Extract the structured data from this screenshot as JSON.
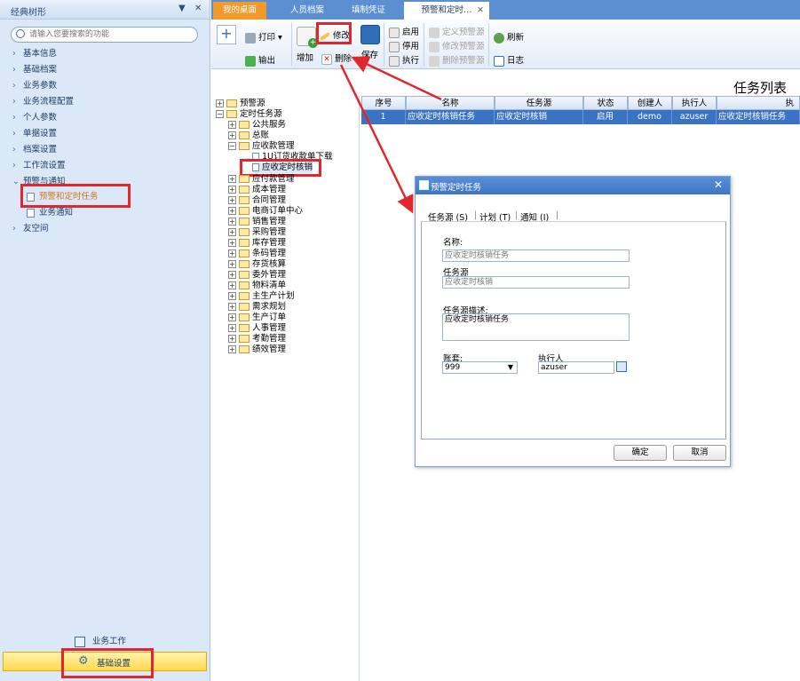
{
  "left_panel": {
    "title": "经典树形",
    "pin_icon": "pin-icon",
    "close_label": "✕",
    "search_placeholder": "请输入您要搜索的功能",
    "nav": [
      "基本信息",
      "基础档案",
      "业务参数",
      "业务流程配置",
      "个人参数",
      "单据设置",
      "档案设置",
      "工作流设置",
      "预警与通知",
      "友空间"
    ],
    "sub_items": [
      "预警和定时任务",
      "业务通知"
    ],
    "bottom": [
      "业务工作",
      "基础设置"
    ]
  },
  "tabs": [
    "我的桌面",
    "人员档案",
    "填制凭证",
    "预警和定时…"
  ],
  "tab_close": "✕",
  "toolbar": {
    "print": "打印",
    "export": "输出",
    "add": "增加",
    "edit": "修改",
    "delete": "删除",
    "save": "保存",
    "enable": "启用",
    "disable": "停用",
    "execute": "执行",
    "define_warning": "定义预警源",
    "modify_warning": "修改预警源",
    "delete_warning": "删除预警源",
    "refresh": "刷新",
    "log": "日志"
  },
  "list_title": "任务列表",
  "tree": {
    "nodes": [
      {
        "label": "预警源",
        "pm": "+"
      },
      {
        "label": "定时任务源",
        "pm": "−"
      },
      {
        "label": "公共服务",
        "pm": "+"
      },
      {
        "label": "总账",
        "pm": "+"
      },
      {
        "label": "应收款管理",
        "pm": "−"
      },
      {
        "label": "1U订货收款单下载",
        "pm": ""
      },
      {
        "label": "应收定时核销",
        "pm": ""
      },
      {
        "label": "应付款管理",
        "pm": "+"
      },
      {
        "label": "成本管理",
        "pm": "+"
      },
      {
        "label": "合同管理",
        "pm": "+"
      },
      {
        "label": "电商订单中心",
        "pm": "+"
      },
      {
        "label": "销售管理",
        "pm": "+"
      },
      {
        "label": "采购管理",
        "pm": "+"
      },
      {
        "label": "库存管理",
        "pm": "+"
      },
      {
        "label": "条码管理",
        "pm": "+"
      },
      {
        "label": "存货核算",
        "pm": "+"
      },
      {
        "label": "委外管理",
        "pm": "+"
      },
      {
        "label": "物料清单",
        "pm": "+"
      },
      {
        "label": "主生产计划",
        "pm": "+"
      },
      {
        "label": "需求规划",
        "pm": "+"
      },
      {
        "label": "生产订单",
        "pm": "+"
      },
      {
        "label": "人事管理",
        "pm": "+"
      },
      {
        "label": "考勤管理",
        "pm": "+"
      },
      {
        "label": "绩效管理",
        "pm": "+"
      }
    ]
  },
  "grid": {
    "headers": [
      "序号",
      "名称",
      "任务源",
      "状态",
      "创建人",
      "执行人",
      "执"
    ],
    "row": [
      "1",
      "应收定时核销任务",
      "应收定时核销",
      "启用",
      "demo",
      "azuser",
      "应收定时核销任务"
    ]
  },
  "dialog": {
    "title": "预警定时任务",
    "tabs": [
      "任务源 (S)",
      "计划 (T)",
      "通知 (I)"
    ],
    "name_label": "名称:",
    "name_value": "应收定时核销任务",
    "source_label": "任务源",
    "source_value": "应收定时核销",
    "desc_label": "任务源描述:",
    "desc_value": "应收定时核销任务",
    "account_label": "账套:",
    "account_value": "999",
    "executor_label": "执行人",
    "executor_value": "azuser",
    "ok": "确定",
    "cancel": "取消"
  },
  "colors": {
    "highlight": "#e1272d",
    "accent": "#3b73c2",
    "tab_active": "#f09a2c"
  }
}
